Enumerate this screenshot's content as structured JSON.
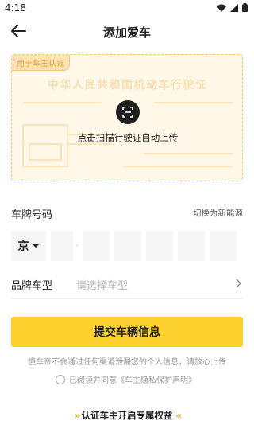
{
  "status_bar": {
    "time": "4:18"
  },
  "header": {
    "title": "添加爱车"
  },
  "license_card": {
    "tag": "用于车主认证",
    "watermark": "中华人民共和国机动车行驶证",
    "scan_label": "点击扫描行驶证自动上传"
  },
  "plate": {
    "label": "车牌号码",
    "switch_label": "切换为新能源",
    "province": "京",
    "separator": "·"
  },
  "brand": {
    "label": "品牌车型",
    "placeholder": "请选择车型"
  },
  "submit": {
    "label": "提交车辆信息"
  },
  "privacy_note": "懂车帝不会通过任何渠道泄漏您的个人信息，请放心上传",
  "agreement": {
    "prefix": "已阅读并同意",
    "link": "《车主隐私保护声明》"
  },
  "benefit": {
    "label": "认证车主开启专属权益"
  },
  "colors": {
    "accent": "#fcd12e",
    "card_bg": "#fff8e8",
    "card_border": "#f2c877"
  }
}
